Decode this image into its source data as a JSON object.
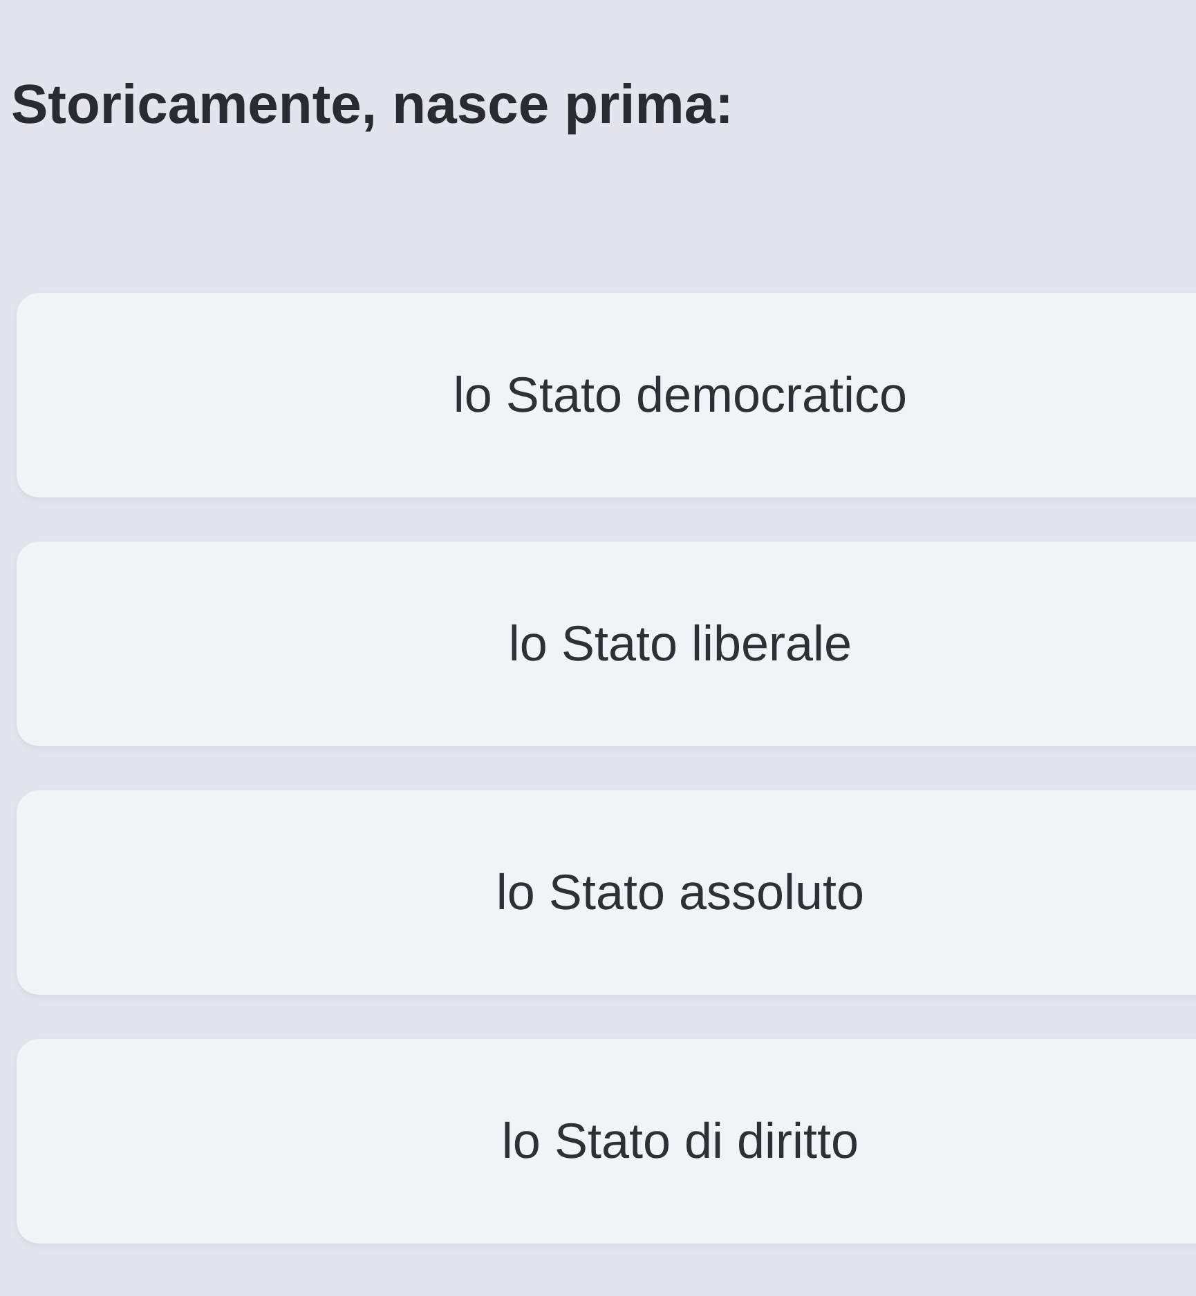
{
  "question": "Storicamente, nasce prima:",
  "options": [
    {
      "label": "lo Stato democratico"
    },
    {
      "label": "lo Stato liberale"
    },
    {
      "label": "lo Stato assoluto"
    },
    {
      "label": "lo Stato di diritto"
    }
  ]
}
